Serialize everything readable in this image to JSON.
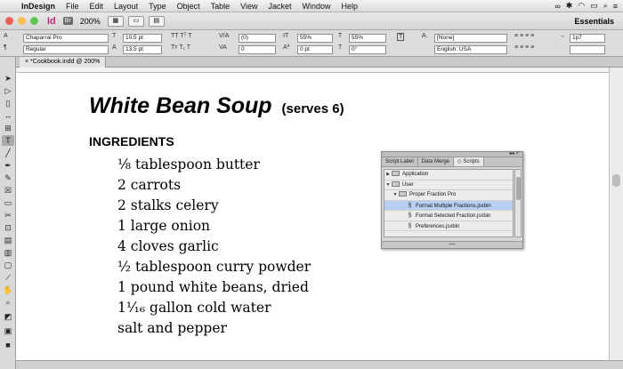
{
  "menubar": {
    "apple": "",
    "app_name": "InDesign",
    "items": [
      "File",
      "Edit",
      "Layout",
      "Type",
      "Object",
      "Table",
      "View",
      "Jacket",
      "Window",
      "Help"
    ]
  },
  "appbar": {
    "logo": "Id",
    "bridge": "Br",
    "zoom": "200%",
    "workspace": "Essentials"
  },
  "control": {
    "font_family": "Chaparral Pro",
    "font_style": "Regular",
    "font_size": "10.5 pt",
    "leading": "13.5 pt",
    "kerning": "(0)",
    "tracking": "0",
    "vscale": "55%",
    "hscale": "55%",
    "baseline": "0 pt",
    "skew": "0°",
    "char_style": "[None]",
    "language": "English: USA",
    "right_field": "1p7"
  },
  "document": {
    "tab_label": "*Cookbook.indd @ 200%",
    "title": "White Bean Soup",
    "serves": "(serves 6)",
    "ingredients_heading": "INGREDIENTS",
    "ingredients": [
      "⅛ tablespoon butter",
      "2 carrots",
      "2 stalks celery",
      "1 large onion",
      "4 cloves garlic",
      "½ tablespoon curry powder",
      "1 pound white beans, dried",
      "1⅟₁₆ gallon cold water",
      "salt and pepper"
    ]
  },
  "scripts_panel": {
    "tabs": [
      "Script Label",
      "Data Merge",
      "Scripts"
    ],
    "active_tab": "Scripts",
    "rows": [
      {
        "label": "Application",
        "type": "folder",
        "indent": 0,
        "expanded": false
      },
      {
        "label": "User",
        "type": "folder",
        "indent": 0,
        "expanded": true
      },
      {
        "label": "Proper Fraction Pro",
        "type": "folder",
        "indent": 1,
        "expanded": true
      },
      {
        "label": "Format Multiple Fractions.jsxbin",
        "type": "script",
        "indent": 2,
        "selected": true
      },
      {
        "label": "Format Selected Fraction.jsxbin",
        "type": "script",
        "indent": 2
      },
      {
        "label": "Preferences.jsxbin",
        "type": "script",
        "indent": 2
      }
    ]
  },
  "colors": {
    "close": "#ec5f57",
    "minimize": "#f5be4f",
    "zoom": "#62c655",
    "selection": "#b8cff2",
    "id_brand": "#c2287a"
  }
}
